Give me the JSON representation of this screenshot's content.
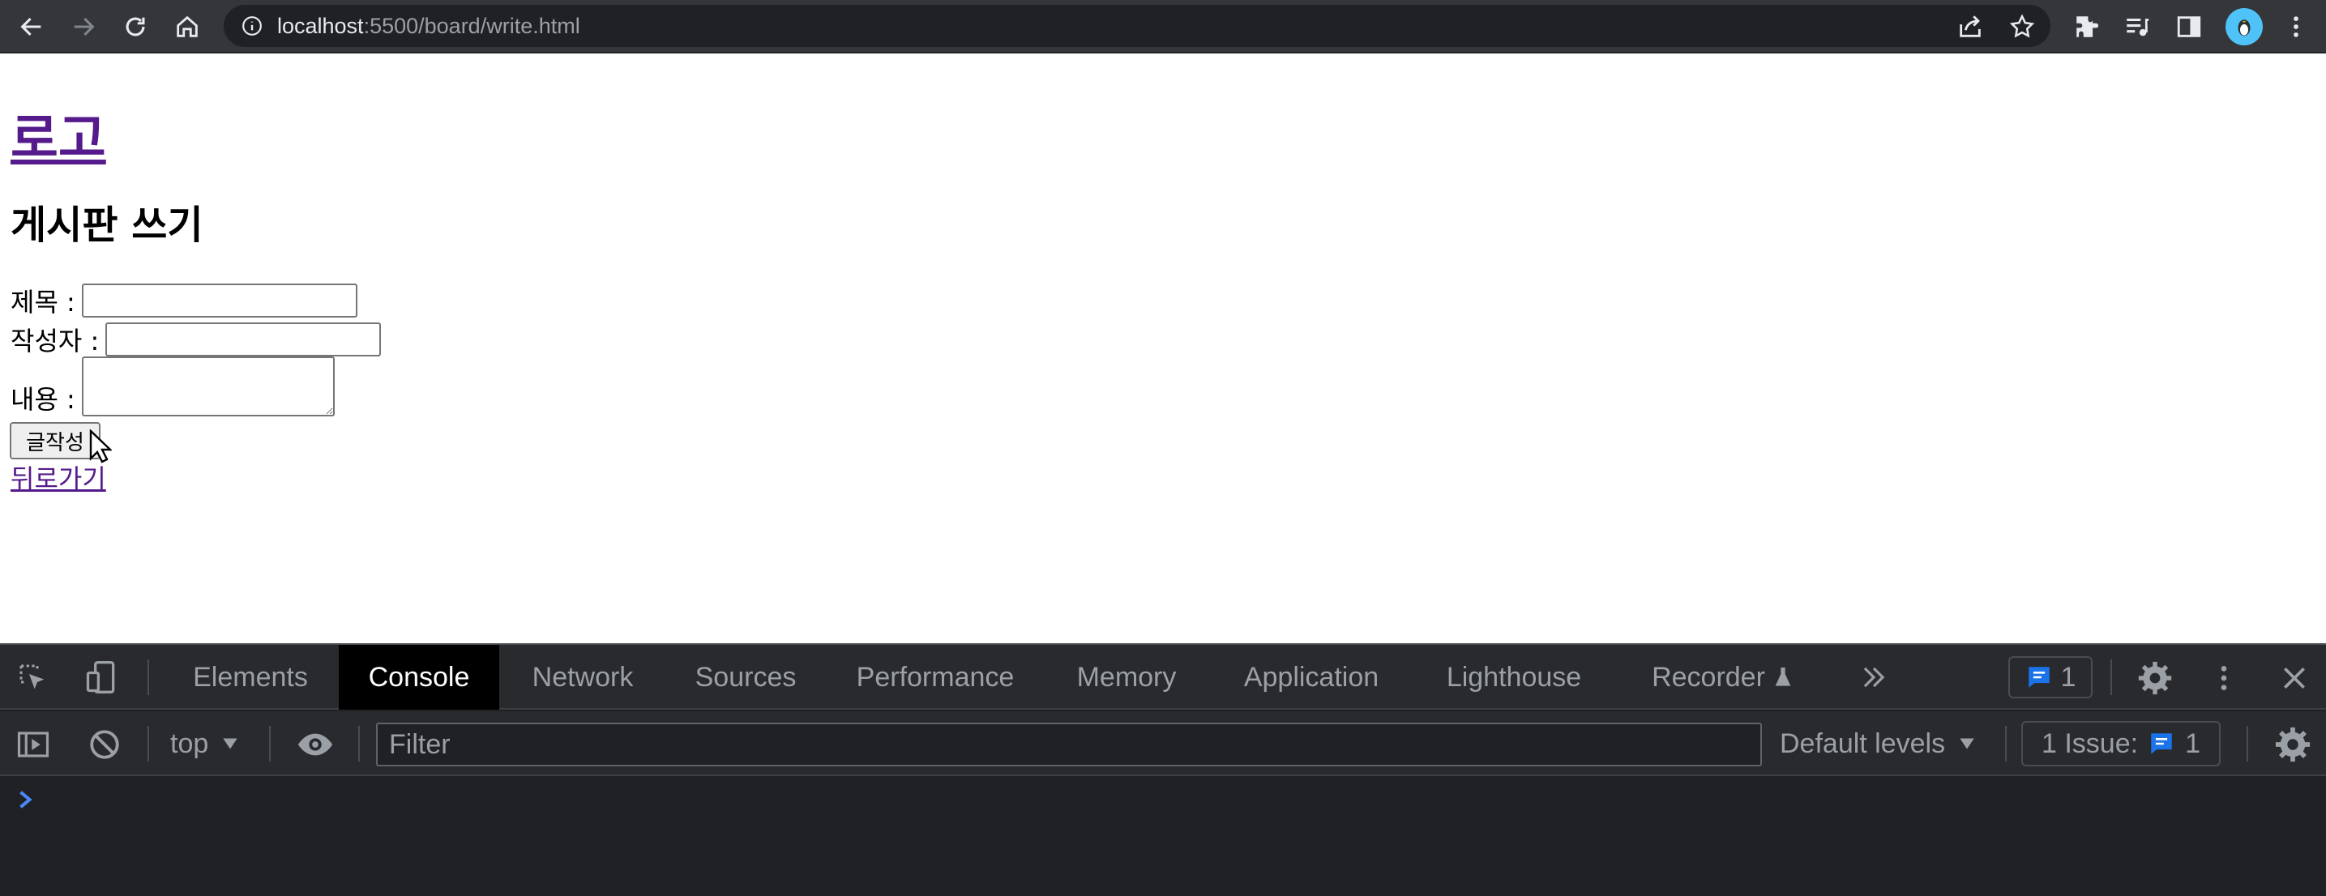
{
  "browser": {
    "url_host": "localhost",
    "url_rest": ":5500/board/write.html"
  },
  "page": {
    "logo": "로고",
    "title": "게시판 쓰기",
    "form": {
      "title_label": "제목 :",
      "author_label": "작성자 :",
      "content_label": "내용 :",
      "title_value": "",
      "author_value": "",
      "content_value": "",
      "submit_label": "글작성",
      "back_link": "뒤로가기"
    }
  },
  "devtools": {
    "tabs": [
      {
        "label": "Elements"
      },
      {
        "label": "Console"
      },
      {
        "label": "Network"
      },
      {
        "label": "Sources"
      },
      {
        "label": "Performance"
      },
      {
        "label": "Memory"
      },
      {
        "label": "Application"
      },
      {
        "label": "Lighthouse"
      },
      {
        "label": "Recorder"
      }
    ],
    "active_tab": "Console",
    "message_count": "1",
    "context": "top",
    "filter_placeholder": "Filter",
    "levels": "Default levels",
    "issues_label": "1 Issue:",
    "issues_count": "1"
  },
  "colors": {
    "link_visited": "#551a8b",
    "devtools_bg": "#202124",
    "accent_blue": "#1a73e8"
  }
}
